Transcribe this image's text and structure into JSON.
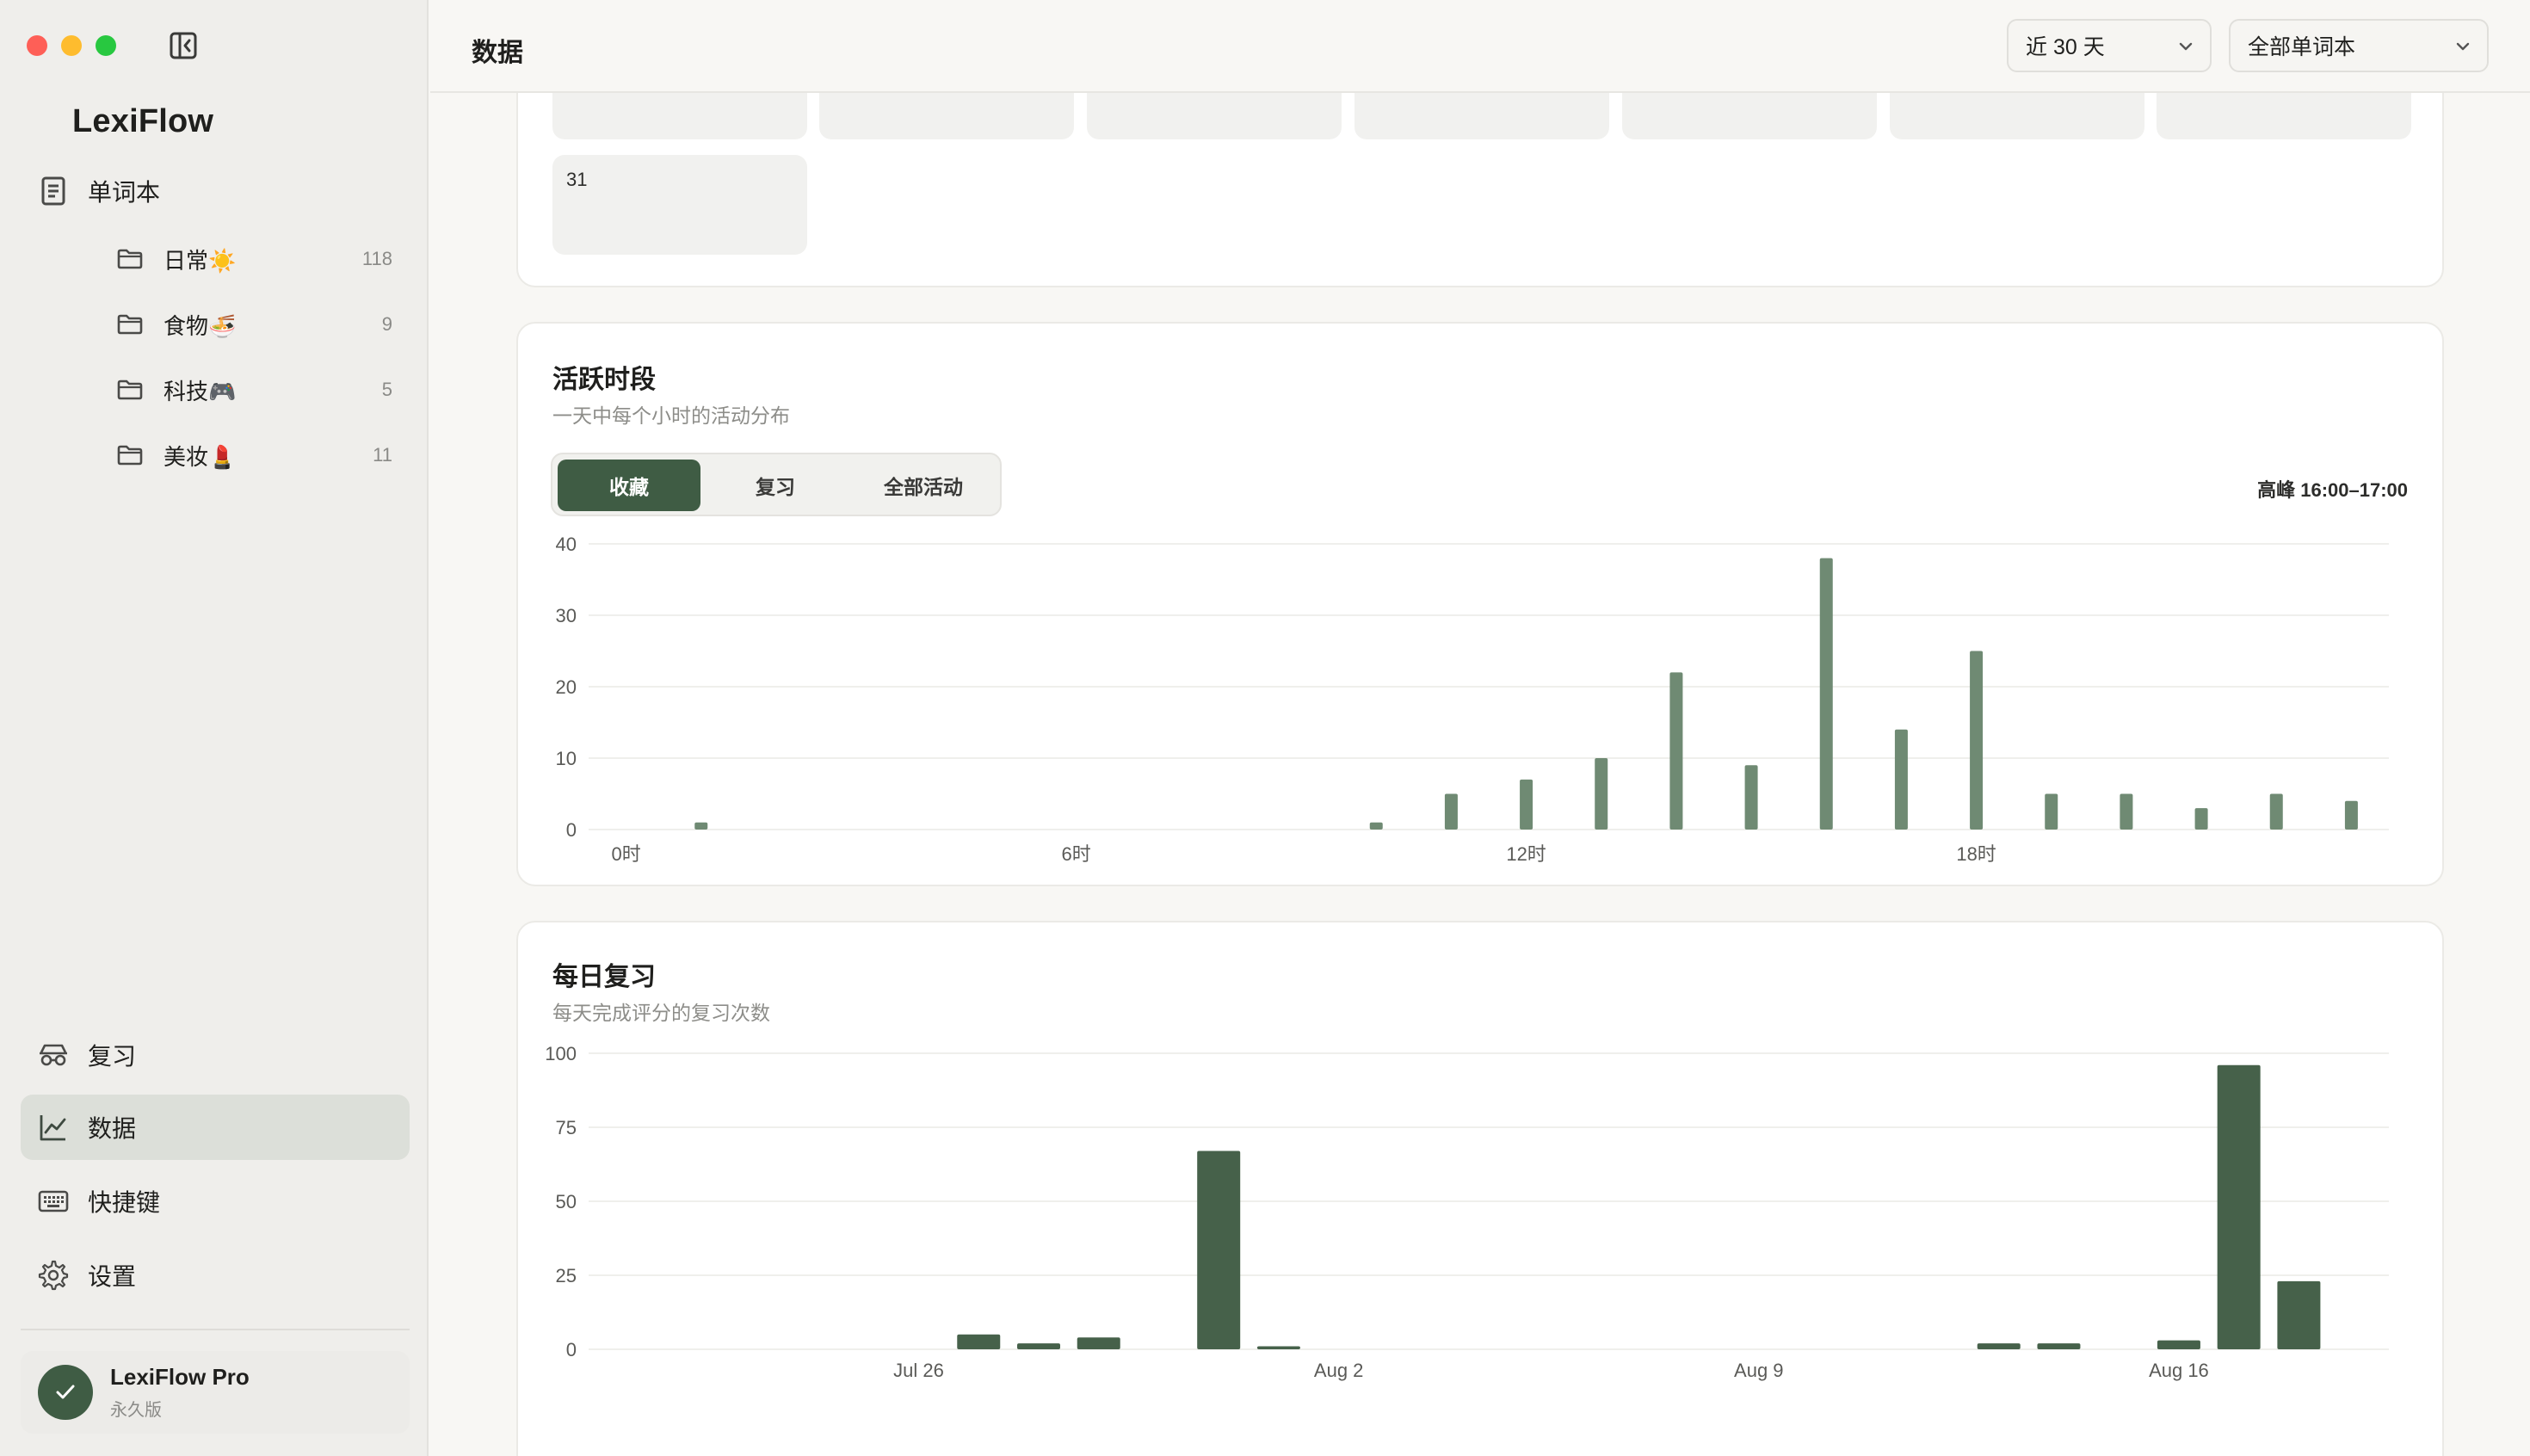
{
  "app": {
    "name": "LexiFlow",
    "colors": {
      "accent": "#3f5c44",
      "bar_light": "#6f8a73",
      "bar_dark": "#46614a"
    }
  },
  "sidebar": {
    "toggle_icon": "sidebar-toggle-icon",
    "vocab_label": "单词本",
    "folders": [
      {
        "label": "日常☀️",
        "count": "118"
      },
      {
        "label": "食物🍜",
        "count": "9"
      },
      {
        "label": "科技🎮",
        "count": "5"
      },
      {
        "label": "美妆💄",
        "count": "11"
      }
    ],
    "nav": [
      {
        "label": "复习",
        "icon": "glasses-icon"
      },
      {
        "label": "数据",
        "icon": "chart-line-icon",
        "active": true
      },
      {
        "label": "快捷键",
        "icon": "keyboard-icon"
      },
      {
        "label": "设置",
        "icon": "gear-icon"
      }
    ],
    "pro": {
      "name": "LexiFlow Pro",
      "sub": "永久版"
    }
  },
  "topbar": {
    "title": "数据",
    "range_select": "近 30 天",
    "book_select": "全部单词本"
  },
  "calendar": {
    "last_cell": "31"
  },
  "hour_card": {
    "title": "活跃时段",
    "subtitle": "一天中每个小时的活动分布",
    "tabs": [
      "收藏",
      "复习",
      "全部活动"
    ],
    "active_tab": 0,
    "peak": "高峰 16:00–17:00"
  },
  "review_card": {
    "title": "每日复习",
    "subtitle": "每天完成评分的复习次数"
  },
  "chart_data": [
    {
      "type": "bar",
      "x": [
        0,
        1,
        2,
        3,
        4,
        5,
        6,
        7,
        8,
        9,
        10,
        11,
        12,
        13,
        14,
        15,
        16,
        17,
        18,
        19,
        20,
        21,
        22,
        23
      ],
      "values": [
        0,
        1,
        0,
        0,
        0,
        0,
        0,
        0,
        0,
        0,
        1,
        5,
        7,
        10,
        22,
        9,
        38,
        14,
        25,
        5,
        5,
        3,
        5,
        4
      ],
      "x_tick_labels": [
        "0时",
        "6时",
        "12时",
        "18时"
      ],
      "x_tick_positions": [
        0,
        6,
        12,
        18
      ],
      "y_ticks": [
        0,
        10,
        20,
        30,
        40
      ],
      "ylim": [
        0,
        40
      ],
      "grid": true
    },
    {
      "type": "bar",
      "x": [
        "Jul 21",
        "Jul 22",
        "Jul 23",
        "Jul 24",
        "Jul 25",
        "Jul 26",
        "Jul 27",
        "Jul 28",
        "Jul 29",
        "Jul 30",
        "Jul 31",
        "Aug 1",
        "Aug 2",
        "Aug 3",
        "Aug 4",
        "Aug 5",
        "Aug 6",
        "Aug 7",
        "Aug 8",
        "Aug 9",
        "Aug 10",
        "Aug 11",
        "Aug 12",
        "Aug 13",
        "Aug 14",
        "Aug 15",
        "Aug 16",
        "Aug 17",
        "Aug 18",
        "Aug 19"
      ],
      "values": [
        0,
        0,
        0,
        0,
        0,
        0,
        5,
        2,
        4,
        0,
        67,
        1,
        0,
        0,
        0,
        0,
        0,
        0,
        0,
        0,
        0,
        0,
        0,
        2,
        2,
        0,
        3,
        96,
        23,
        0
      ],
      "x_tick_labels": [
        "Jul 26",
        "Aug 2",
        "Aug 9",
        "Aug 16"
      ],
      "y_ticks": [
        0,
        25,
        50,
        75,
        100
      ],
      "ylim": [
        0,
        100
      ],
      "grid": true
    }
  ]
}
